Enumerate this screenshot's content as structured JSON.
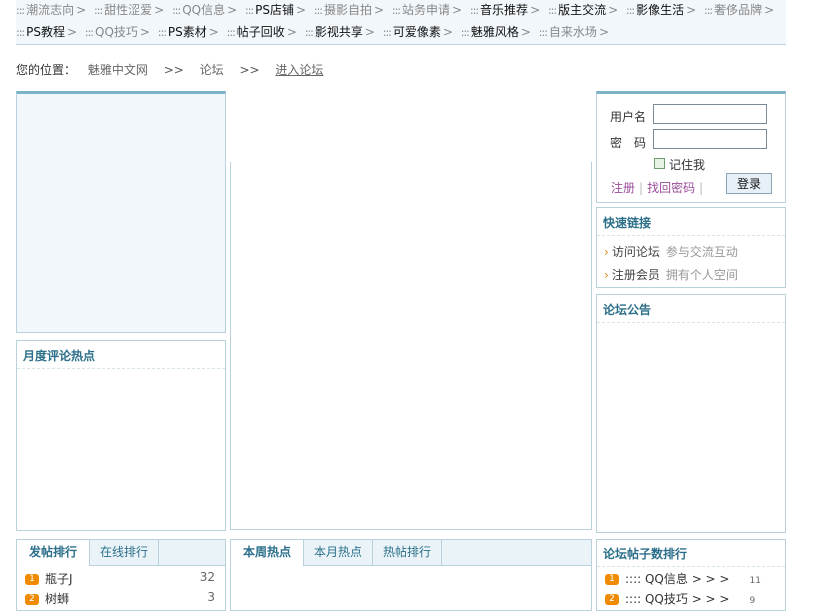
{
  "nav": {
    "row1": [
      {
        "label": "潮流志向",
        "style": "dim"
      },
      {
        "label": "甜性涩爱",
        "style": "dim"
      },
      {
        "label": "QQ信息",
        "style": "dim"
      },
      {
        "label": "PS店铺",
        "style": "dark"
      },
      {
        "label": "摄影自拍",
        "style": "dim"
      },
      {
        "label": "站务申请",
        "style": "dim"
      },
      {
        "label": "音乐推荐",
        "style": "dark"
      },
      {
        "label": "版主交流",
        "style": "dark"
      },
      {
        "label": "影像生活",
        "style": "dark"
      },
      {
        "label": "奢侈品牌",
        "style": "dim"
      }
    ],
    "row2": [
      {
        "label": "PS教程",
        "style": "dark"
      },
      {
        "label": "QQ技巧",
        "style": "dim"
      },
      {
        "label": "PS素材",
        "style": "dark"
      },
      {
        "label": "帖子回收",
        "style": "dark"
      },
      {
        "label": "影视共享",
        "style": "dark"
      },
      {
        "label": "可爱像素",
        "style": "dark"
      },
      {
        "label": "魅雅风格",
        "style": "dark"
      },
      {
        "label": "自来水场",
        "style": "dim"
      }
    ],
    "dots": ":::",
    "arrow": ">"
  },
  "breadcrumb": {
    "prefix": "您的位置：",
    "items": [
      "魅雅中文网",
      "论坛",
      "进入论坛"
    ],
    "sep": ">>"
  },
  "login": {
    "username_label": "用户名",
    "password_label": "密　码",
    "remember_label": "记住我",
    "register_link": "注册",
    "forgot_link": "找回密码",
    "login_button": "登录"
  },
  "quick_links": {
    "title": "快速链接",
    "items": [
      {
        "name": "访问论坛",
        "desc": "参与交流互动"
      },
      {
        "name": "注册会员",
        "desc": "拥有个人空间"
      }
    ]
  },
  "announcement": {
    "title": "论坛公告"
  },
  "monthly_hot": {
    "title": "月度评论热点"
  },
  "post_rank": {
    "tabs": [
      "发帖排行",
      "在线排行"
    ],
    "rows": [
      {
        "badge": "1",
        "name": "瓶子J",
        "count": "32"
      },
      {
        "badge": "2",
        "name": "树蛳",
        "count": "3"
      }
    ]
  },
  "hot_tabs": {
    "tabs": [
      "本周热点",
      "本月热点",
      "热帖排行"
    ]
  },
  "forum_post_rank": {
    "title": "论坛帖子数排行",
    "rows": [
      {
        "badge": "1",
        "name": ":::: QQ信息 > > >",
        "count": "11"
      },
      {
        "badge": "2",
        "name": ":::: QQ技巧 > > >",
        "count": "9"
      }
    ]
  },
  "colors": {
    "accent": "#2c6f8a",
    "badge": "#f08a00",
    "border": "#b9d1da"
  }
}
